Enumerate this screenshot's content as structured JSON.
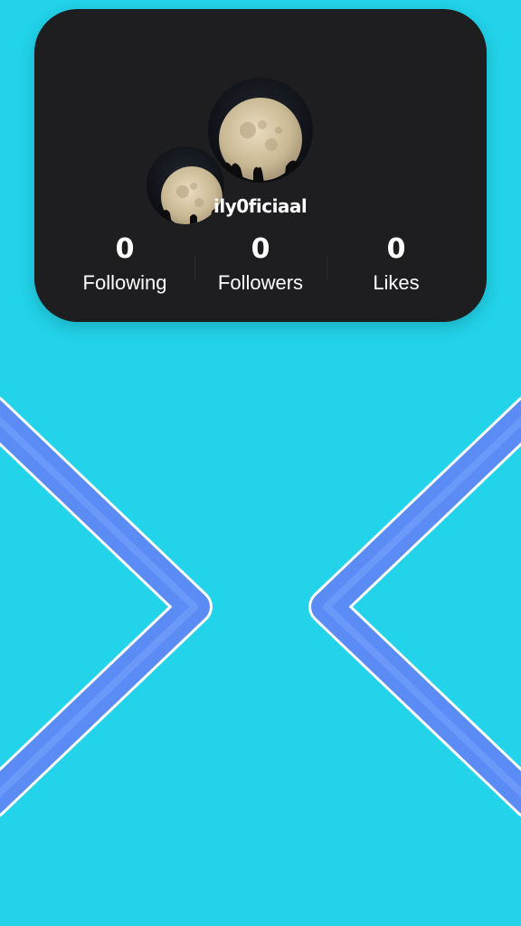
{
  "profile": {
    "username": "ily0ficiaal",
    "avatar_large": "moon-avatar-icon",
    "avatar_small": "moon-avatar-icon"
  },
  "stats": {
    "following": {
      "value": "0",
      "label": "Following"
    },
    "followers": {
      "value": "0",
      "label": "Followers"
    },
    "likes": {
      "value": "0",
      "label": "Likes"
    }
  },
  "colors": {
    "background": "#22d3e9",
    "card": "#1e1e20",
    "chevron": "#5b8cf5",
    "chevron_outline": "#ffffff",
    "text": "#ffffff"
  },
  "icons": {
    "left_chevron": "chevron-right-icon",
    "right_chevron": "chevron-left-icon"
  }
}
